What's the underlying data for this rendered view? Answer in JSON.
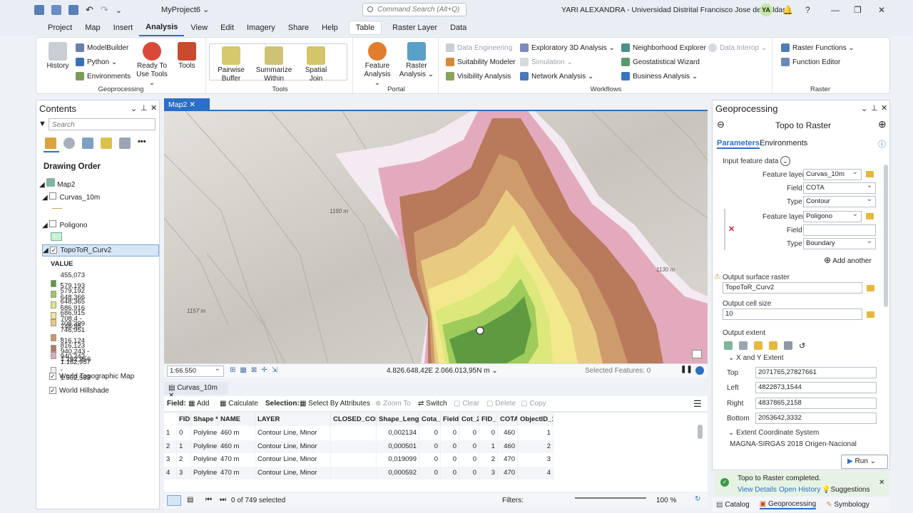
{
  "window": {
    "project": "MyProject6 ⌄",
    "command_search_placeholder": "Command Search (Alt+Q)",
    "user": "YARI ALEXANDRA - Universidad Distrital Francisco Jose de Caldas",
    "avatar": "YA"
  },
  "menu": {
    "tabs": [
      "Project",
      "Map",
      "Insert",
      "Analysis",
      "View",
      "Edit",
      "Imagery",
      "Share",
      "Help"
    ],
    "context_tab": "Table",
    "extra_tabs": [
      "Raster Layer",
      "Data"
    ]
  },
  "ribbon": {
    "geoprocessing": {
      "label": "Geoprocessing",
      "history": "History",
      "modelbuilder": "ModelBuilder",
      "python": "Python ⌄",
      "environments": "Environments",
      "ready": "Ready To Use Tools ⌄",
      "tools": "Tools"
    },
    "tools": {
      "label": "Tools",
      "items": [
        "Pairwise Buffer",
        "Summarize Within",
        "Spatial Join"
      ]
    },
    "portal": {
      "label": "Portal",
      "feature": "Feature Analysis ⌄",
      "raster": "Raster Analysis ⌄"
    },
    "workflows": {
      "label": "Workflows",
      "data_engineering": "Data Engineering",
      "suitability": "Suitability Modeler",
      "visibility": "Visibility Analysis",
      "exploratory": "Exploratory 3D Analysis ⌄",
      "simulation": "Simulation ⌄",
      "network": "Network Analysis ⌄",
      "neighborhood": "Neighborhood Explorer",
      "geostat": "Geostatistical Wizard",
      "business": "Business Analysis ⌄",
      "interop": "Data Interop ⌄"
    },
    "raster": {
      "label": "Raster",
      "functions": "Raster Functions ⌄",
      "editor": "Function Editor"
    }
  },
  "contents": {
    "title": "Contents",
    "search_placeholder": "Search",
    "drawing_order": "Drawing Order",
    "map": "Map2",
    "layers": [
      "Curvas_10m",
      "Poligono",
      "TopoToR_Curv2"
    ],
    "value_label": "VALUE",
    "legend": [
      {
        "label": "455,073 - 579,192",
        "color": "#5d9a3f"
      },
      {
        "label": "579,193 - 648,365",
        "color": "#9ccb5b"
      },
      {
        "label": "648,366 - 686,915",
        "color": "#dbe67b"
      },
      {
        "label": "686,916 - 708,399",
        "color": "#f1e78b"
      },
      {
        "label": "708,4 - 746,95",
        "color": "#e8c980"
      },
      {
        "label": "746,951 - 816,123",
        "color": "#cc9a6b"
      },
      {
        "label": "816,124 - 940,242",
        "color": "#b9785b"
      },
      {
        "label": "940,243 - 1.162,956",
        "color": "#e1a9be"
      },
      {
        "label": "1.162,957 - 1.562,583",
        "color": "#f6eef4"
      }
    ],
    "basemaps": [
      "World Topographic Map",
      "World Hillshade"
    ]
  },
  "map": {
    "tab": "Map2",
    "scale": "1:66.550",
    "coords": "4.826.648,42E 2.066.013,95N m",
    "selected_features": "Selected Features: 0",
    "labels": [
      "1160 m",
      "1130 m",
      "1157 m"
    ]
  },
  "table": {
    "tab": "Curvas_10m",
    "field_label": "Field:",
    "add": "Add",
    "calculate": "Calculate",
    "selection_label": "Selection:",
    "select_by_attr": "Select By Attributes",
    "zoom_to": "Zoom To",
    "switch": "Switch",
    "clear": "Clear",
    "delete": "Delete",
    "copy": "Copy",
    "columns": [
      "FID",
      "Shape *",
      "NAME",
      "LAYER",
      "CLOSED_CON",
      "Shape_Leng",
      "Cota_1",
      "Field",
      "Cot_2",
      "FID_",
      "COTA",
      "ObjectID_1"
    ],
    "rows": [
      [
        "1",
        "0",
        "Polyline",
        "460 m",
        "Contour Line, Minor",
        "",
        "0,002134",
        "0",
        "0",
        "0",
        "0",
        "460",
        "1"
      ],
      [
        "2",
        "1",
        "Polyline",
        "460 m",
        "Contour Line, Minor",
        "",
        "0,000501",
        "0",
        "0",
        "0",
        "1",
        "460",
        "2"
      ],
      [
        "3",
        "2",
        "Polyline",
        "470 m",
        "Contour Line, Minor",
        "",
        "0,019099",
        "0",
        "0",
        "0",
        "2",
        "470",
        "3"
      ],
      [
        "4",
        "3",
        "Polyline",
        "470 m",
        "Contour Line, Minor",
        "",
        "0,000592",
        "0",
        "0",
        "0",
        "3",
        "470",
        "4"
      ]
    ],
    "selected": "0 of 749 selected",
    "filters": "Filters:",
    "zoom": "100 %"
  },
  "gp": {
    "title": "Geoprocessing",
    "tool": "Topo to Raster",
    "tab_params": "Parameters",
    "tab_env": "Environments",
    "input_label": "Input feature data",
    "feature_layer": "Feature layer",
    "field": "Field",
    "type": "Type",
    "layer1": "Curvas_10m",
    "field1": "COTA",
    "type1": "Contour",
    "layer2": "Poligono",
    "field2": "",
    "type2": "Boundary",
    "add_another": "Add another",
    "output_raster_label": "Output surface raster",
    "output_raster": "TopoToR_Curv2",
    "cell_size_label": "Output cell size",
    "cell_size": "10",
    "extent_label": "Output extent",
    "xy_extent": "X and Y Extent",
    "top_label": "Top",
    "top": "2071765,27827661",
    "left_label": "Left",
    "left": "4822873,1544",
    "right_label": "Right",
    "right": "4837865,2158",
    "bottom_label": "Bottom",
    "bottom": "2053642,3332",
    "ecs_label": "Extent Coordinate System",
    "ecs": "MAGNA-SIRGAS 2018 Origen-Nacional",
    "run": "Run",
    "notif": "Topo to Raster completed.",
    "view_details": "View Details",
    "open_history": "Open History",
    "suggestions": "Suggestions"
  },
  "bottom_tabs": [
    "Catalog",
    "Geoprocessing",
    "Symbology"
  ]
}
